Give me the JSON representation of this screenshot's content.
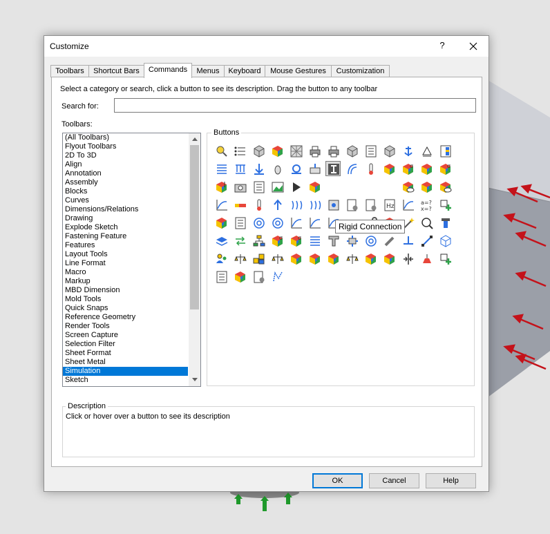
{
  "dialog": {
    "title": "Customize",
    "help_glyph": "?",
    "tabs": [
      {
        "label": "Toolbars",
        "active": false
      },
      {
        "label": "Shortcut Bars",
        "active": false
      },
      {
        "label": "Commands",
        "active": true
      },
      {
        "label": "Menus",
        "active": false
      },
      {
        "label": "Keyboard",
        "active": false
      },
      {
        "label": "Mouse Gestures",
        "active": false
      },
      {
        "label": "Customization",
        "active": false
      }
    ],
    "instructions": "Select a category or search, click a button to see its description. Drag the button to any toolbar",
    "search": {
      "label": "Search for:",
      "value": ""
    },
    "toolbars_label": "Toolbars:",
    "toolbars": [
      "(All Toolbars)",
      "Flyout Toolbars",
      "2D To 3D",
      "Align",
      "Annotation",
      "Assembly",
      "Blocks",
      "Curves",
      "Dimensions/Relations",
      "Drawing",
      "Explode Sketch",
      "Fastening Feature",
      "Features",
      "Layout Tools",
      "Line Format",
      "Macro",
      "Markup",
      "MBD Dimension",
      "Mold Tools",
      "Quick Snaps",
      "Reference Geometry",
      "Render Tools",
      "Screen Capture",
      "Selection Filter",
      "Sheet Format",
      "Sheet Metal",
      "Simulation",
      "Sketch"
    ],
    "selected_toolbar": "Simulation",
    "buttons_label": "Buttons",
    "tooltip": "Rigid Connection",
    "description": {
      "label": "Description",
      "text": "Click or hover over a button to see its description"
    },
    "footer": {
      "ok": "OK",
      "cancel": "Cancel",
      "help": "Help"
    }
  },
  "icon_rows": [
    [
      "magnifier-icon",
      "list-icon",
      "solid-part-icon",
      "stress-plot-icon",
      "mesh-icon",
      "printer-icon",
      "printer-alt-icon",
      "cube-icon",
      "property-list-icon",
      "parts-icon",
      "anchor-icon",
      "pin-support-icon",
      "results-table-icon"
    ],
    [
      "spring-icon",
      "roller-icon",
      "force-arrow-icon",
      "bearing-icon",
      "fixture-icon",
      "remote-load-icon",
      "rigid-connection-icon",
      "shell-icon",
      "thermometer-icon",
      "stress-plot-icon",
      "stress-sigma-icon",
      "stress-plot-icon",
      "stress-sigma-icon"
    ],
    [
      "probe-icon",
      "camera-icon",
      "report-icon",
      "photo-icon",
      "play-icon",
      "solid-color-icon",
      "tooltip-hidden",
      "tooltip-hidden",
      "tooltip-hidden",
      "tooltip-hidden",
      "cut-plot-icon",
      "solid-color-icon",
      "eye-plot-icon"
    ],
    [
      "graph-icon",
      "beam-icon",
      "temperature-icon",
      "upload-arrow-icon",
      "convection-icon",
      "radiation-icon",
      "contact-icon",
      "document-gear-icon",
      "document-gear-icon",
      "chart-hz-icon",
      "curve-graph-icon",
      "equation-icon",
      "add-plus-icon"
    ],
    [
      "stress-plot-icon",
      "document-list-icon",
      "target-icon",
      "target-icon",
      "line-graph-icon",
      "line-graph-icon",
      "line-graph-icon",
      "time-t0-icon",
      "wrench-icon",
      "stress-plot-icon",
      "magic-wand-icon",
      "zoom-icon",
      "bolt-icon"
    ],
    [
      "layers-icon",
      "swap-icon",
      "tree-icon",
      "cube-sigma-icon",
      "stress-sigma-icon",
      "coil-icon",
      "t-beam-icon",
      "connector-icon",
      "ring-icon",
      "pin-icon",
      "ground-icon",
      "line-icon",
      "cube-frame-icon"
    ],
    [
      "users-icon",
      "balance-icon",
      "assembly-icon",
      "balance-icon",
      "stress-plot-icon",
      "stress-plot-icon",
      "stress-plot-icon",
      "balance-icon",
      "stress-plot-icon",
      "stress-plot-icon",
      "split-icon",
      "mass-icon",
      "plus-cross-icon"
    ],
    [
      "document-list-icon",
      "stress-plot-icon",
      "document-check-icon",
      "sketch-icon"
    ]
  ],
  "hovered_icon": [
    1,
    6
  ]
}
